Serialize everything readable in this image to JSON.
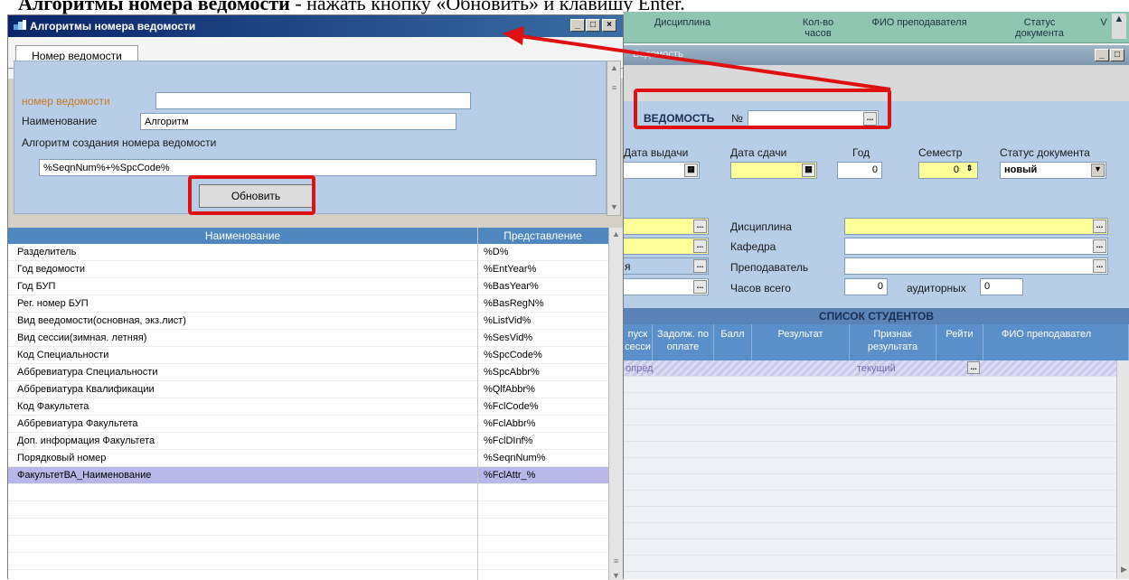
{
  "doc_heading": {
    "bold_part": "Алгоритмы номера ведомости",
    "rest": " - нажать кнопку «Обновить» и клавишу Enter."
  },
  "bg": {
    "top_columns": [
      {
        "label": "Дисциплина"
      },
      {
        "label": "Кол-во часов"
      },
      {
        "label": "ФИО преподавателя"
      },
      {
        "label": "Статус документа"
      },
      {
        "label": "V"
      }
    ],
    "window_title": "Ведомость",
    "form": {
      "vedomost_label": "ВЕДОМОСТЬ",
      "number_label": "№",
      "number_value": "",
      "date_issue_label": "Дата выдачи",
      "date_return_label": "Дата сдачи",
      "year_label": "Год",
      "year_value": "0",
      "semester_label": "Семестр",
      "semester_value": "0",
      "status_label": "Статус документа",
      "status_value": "новый",
      "discipline_label": "Дисциплина",
      "department_label": "Кафедра",
      "teacher_label": "Преподаватель",
      "hours_total_label": "Часов всего",
      "hours_total_value": "0",
      "auditorium_label": "аудиторных",
      "auditorium_value": "0",
      "row3_partial": "я"
    },
    "students_title": "СПИСОК СТУДЕНТОВ",
    "students_columns": [
      "пуск сесси",
      "Задолж. по оплате",
      "Балл",
      "Результат",
      "Признак результата",
      "Рейти",
      "ФИО преподавател"
    ],
    "students_first_row": {
      "c0": "опред",
      "c4": "текущий"
    }
  },
  "dialog": {
    "title": "Алгоритмы номера ведомости",
    "tab_label": "Номер ведомости",
    "fields": {
      "number_label": "номер ведомости",
      "number_value": "",
      "name_label": "Наименование",
      "name_value": "Алгоритм",
      "algo_label": "Алгоритм создания номера ведомости",
      "algo_value": "%SeqnNum%+%SpcCode%"
    },
    "refresh_button": "Обновить",
    "grid": {
      "col_name": "Наименование",
      "col_repr": "Представление",
      "rows": [
        {
          "name": "Разделитель",
          "repr": "%D%"
        },
        {
          "name": "Год ведомости",
          "repr": "%EntYear%"
        },
        {
          "name": "Год БУП",
          "repr": "%BasYear%"
        },
        {
          "name": "Рег. номер БУП",
          "repr": "%BasRegN%"
        },
        {
          "name": "Вид вeeдомости(основная, экз.лист)",
          "repr": "%ListVid%"
        },
        {
          "name": "Вид сессии(зимная. летняя)",
          "repr": "%SesVid%"
        },
        {
          "name": "Код Специальности",
          "repr": "%SpcCode%"
        },
        {
          "name": "Аббревиатура Специальности",
          "repr": "%SpcAbbr%"
        },
        {
          "name": "Аббревиатура Квалификации",
          "repr": "%QlfAbbr%"
        },
        {
          "name": "Код Факультета",
          "repr": "%FclCode%"
        },
        {
          "name": "Аббревиатура Факультета",
          "repr": "%FclAbbr%"
        },
        {
          "name": "Доп. информация Факультета",
          "repr": "%FclDInf%"
        },
        {
          "name": "Порядковый номер",
          "repr": "%SeqnNum%"
        },
        {
          "name": "ФакультетВА_Наименование",
          "repr": "%FclAttr_%"
        }
      ]
    }
  },
  "colors": {
    "annotation_red": "#e01010",
    "dialog_title": "#0a246a",
    "form_bg": "#b8cde8",
    "grid_header": "#4f87c0",
    "selected_row": "#b8b8e8",
    "required_field": "#ffff99"
  }
}
